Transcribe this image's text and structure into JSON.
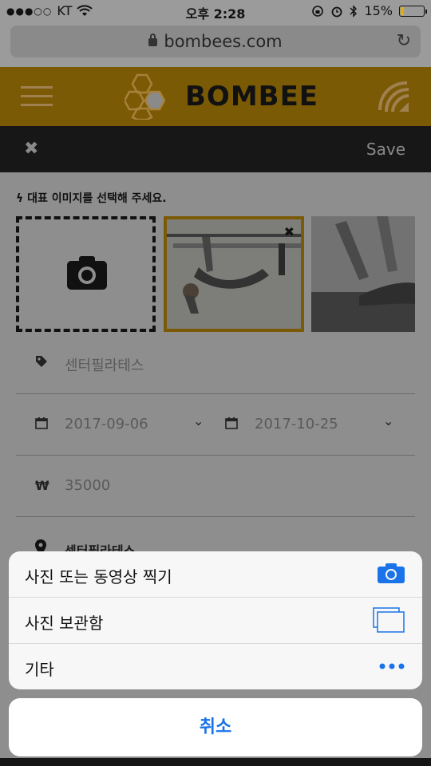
{
  "status_bar": {
    "carrier": "KT",
    "time": "오후 2:28",
    "battery": "15%",
    "battery_level": 0.15
  },
  "browser": {
    "url": "bombees.com"
  },
  "brand": {
    "name": "BOMBEE"
  },
  "action_bar": {
    "save_label": "Save"
  },
  "form": {
    "hint": "대표 이미지를 선택해 주세요.",
    "name_value": "센터필라테스",
    "start_date": "2017-09-06",
    "end_date": "2017-10-25",
    "price": "35000",
    "price_symbol": "₩",
    "location": "센터필라테스"
  },
  "action_sheet": {
    "items": [
      {
        "label": "사진 또는 동영상 찍기",
        "icon": "camera-icon"
      },
      {
        "label": "사진 보관함",
        "icon": "photo-library-icon"
      },
      {
        "label": "기타",
        "icon": "more-icon"
      }
    ],
    "cancel_label": "취소"
  },
  "colors": {
    "brand_gold": "#7a5a05",
    "ios_blue": "#1a73e8"
  }
}
